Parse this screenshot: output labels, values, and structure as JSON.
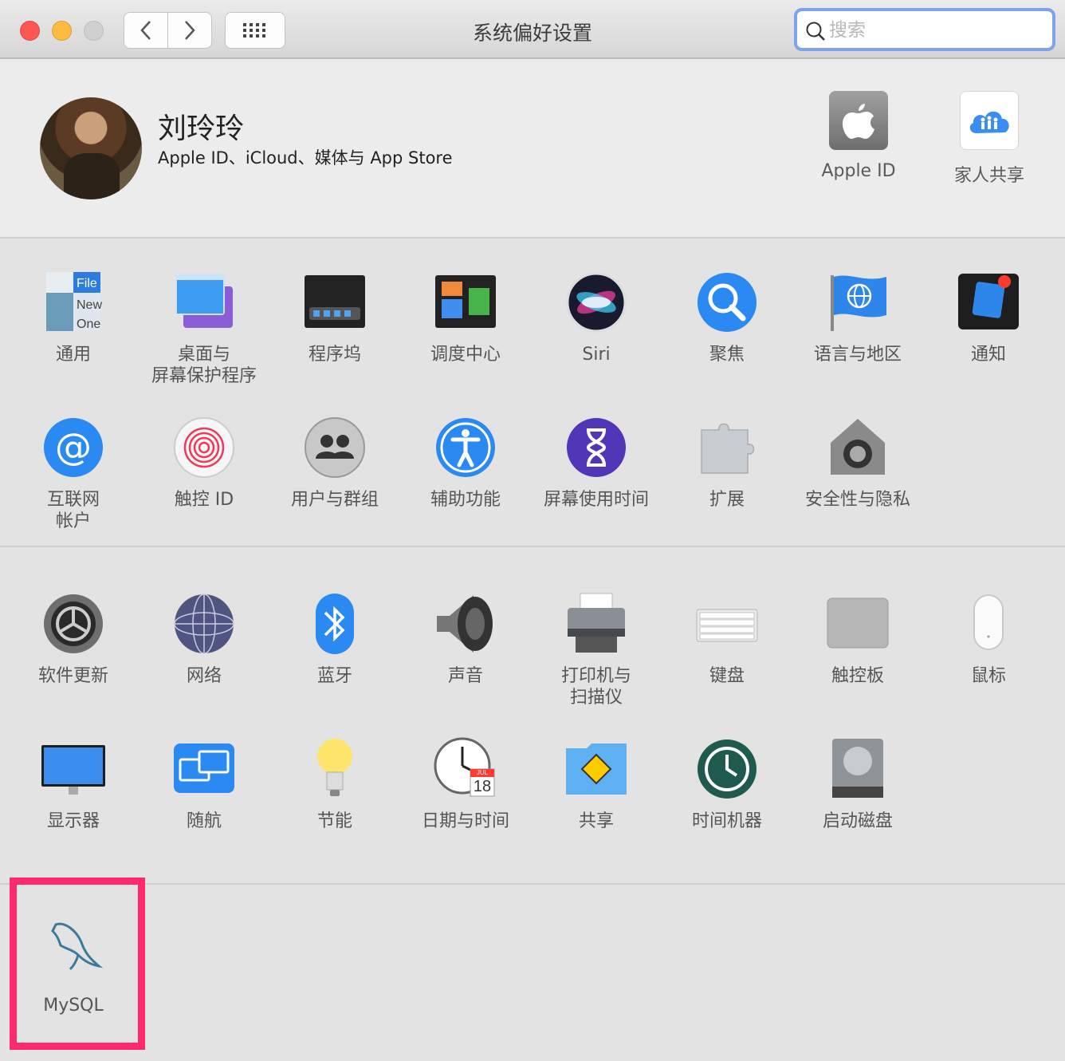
{
  "window": {
    "title": "系统偏好设置",
    "search_placeholder": "搜索"
  },
  "account": {
    "name": "刘玲玲",
    "subtitle": "Apple ID、iCloud、媒体与 App Store",
    "items": [
      {
        "label": "Apple ID",
        "icon": "apple-id-icon"
      },
      {
        "label": "家人共享",
        "icon": "family-sharing-icon"
      }
    ]
  },
  "row1": [
    {
      "label": "通用",
      "icon": "general-icon"
    },
    {
      "label": "桌面与\n屏幕保护程序",
      "icon": "desktop-screensaver-icon"
    },
    {
      "label": "程序坞",
      "icon": "dock-icon"
    },
    {
      "label": "调度中心",
      "icon": "mission-control-icon"
    },
    {
      "label": "Siri",
      "icon": "siri-icon"
    },
    {
      "label": "聚焦",
      "icon": "spotlight-icon"
    },
    {
      "label": "语言与地区",
      "icon": "language-region-icon"
    },
    {
      "label": "通知",
      "icon": "notifications-icon"
    }
  ],
  "row2": [
    {
      "label": "互联网\n帐户",
      "icon": "internet-accounts-icon"
    },
    {
      "label": "触控 ID",
      "icon": "touch-id-icon"
    },
    {
      "label": "用户与群组",
      "icon": "users-groups-icon"
    },
    {
      "label": "辅助功能",
      "icon": "accessibility-icon"
    },
    {
      "label": "屏幕使用时间",
      "icon": "screen-time-icon"
    },
    {
      "label": "扩展",
      "icon": "extensions-icon"
    },
    {
      "label": "安全性与隐私",
      "icon": "security-privacy-icon"
    }
  ],
  "row3": [
    {
      "label": "软件更新",
      "icon": "software-update-icon"
    },
    {
      "label": "网络",
      "icon": "network-icon"
    },
    {
      "label": "蓝牙",
      "icon": "bluetooth-icon"
    },
    {
      "label": "声音",
      "icon": "sound-icon"
    },
    {
      "label": "打印机与\n扫描仪",
      "icon": "printers-scanners-icon"
    },
    {
      "label": "键盘",
      "icon": "keyboard-icon"
    },
    {
      "label": "触控板",
      "icon": "trackpad-icon"
    },
    {
      "label": "鼠标",
      "icon": "mouse-icon"
    }
  ],
  "row4": [
    {
      "label": "显示器",
      "icon": "displays-icon"
    },
    {
      "label": "随航",
      "icon": "sidecar-icon"
    },
    {
      "label": "节能",
      "icon": "energy-saver-icon"
    },
    {
      "label": "日期与时间",
      "icon": "date-time-icon",
      "calendar_month": "JUL",
      "calendar_day": "18"
    },
    {
      "label": "共享",
      "icon": "sharing-icon"
    },
    {
      "label": "时间机器",
      "icon": "time-machine-icon"
    },
    {
      "label": "启动磁盘",
      "icon": "startup-disk-icon"
    }
  ],
  "other": [
    {
      "label": "MySQL",
      "icon": "mysql-dolphin-icon"
    }
  ]
}
